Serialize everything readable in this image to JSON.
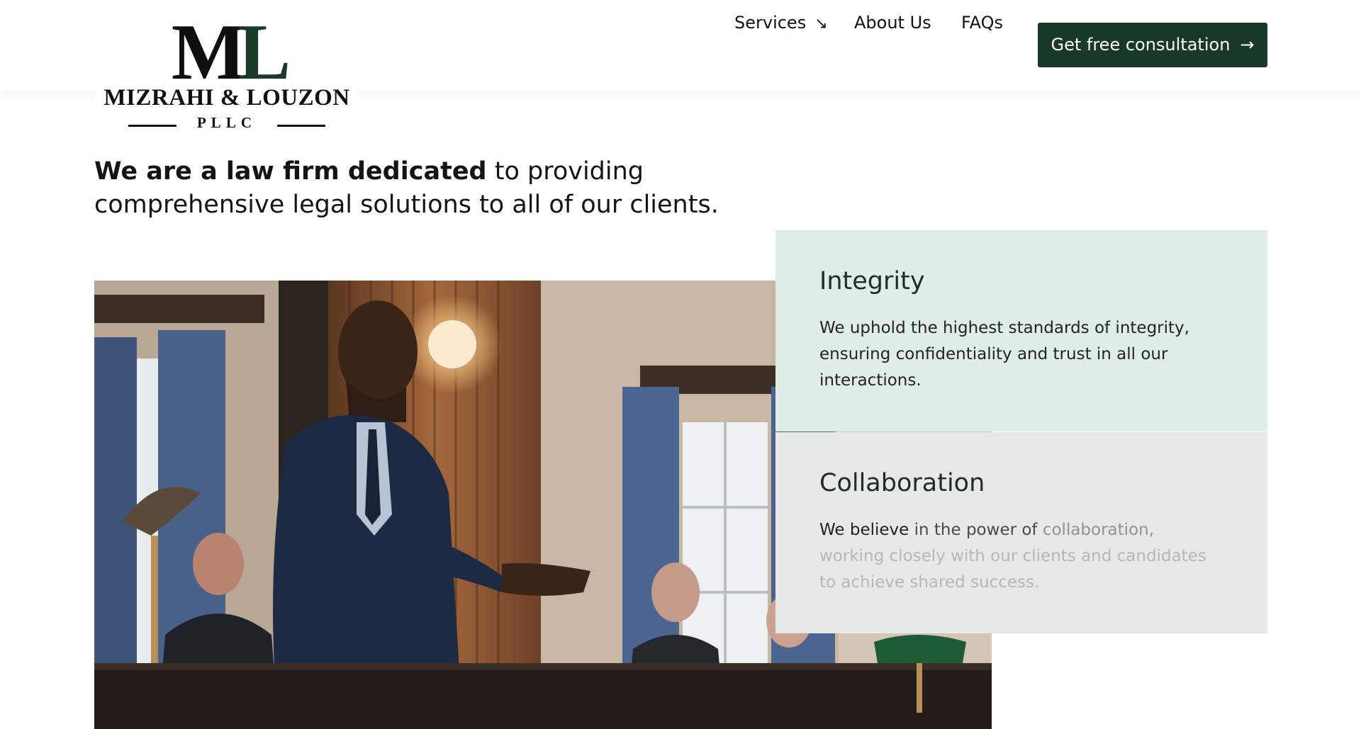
{
  "logo": {
    "monogram_m": "M",
    "monogram_l": "L",
    "name": "MIZRAHI & LOUZON",
    "sub": "PLLC"
  },
  "nav": {
    "services": "Services",
    "services_arrow": "↘",
    "about": "About Us",
    "faqs": "FAQs",
    "cta_label": "Get free consultation",
    "cta_arrow": "→"
  },
  "intro": {
    "strong": "We are a law firm dedicated",
    "rest": " to providing comprehensive legal solutions to all of our clients."
  },
  "cards": {
    "integrity": {
      "title": "Integrity",
      "body": "We uphold the highest standards of integrity, ensuring confidentiality and trust in all our interactions."
    },
    "collaboration": {
      "title": "Collaboration",
      "body_1": "We believe",
      "body_2": " in the power of",
      "body_3": " collaboration,",
      "body_4": " working closely with our clients and candidates to achieve shared success."
    }
  },
  "colors": {
    "brand_green": "#183828",
    "integrity_bg": "#e0ede5",
    "collab_bg": "#e6e9e7"
  }
}
